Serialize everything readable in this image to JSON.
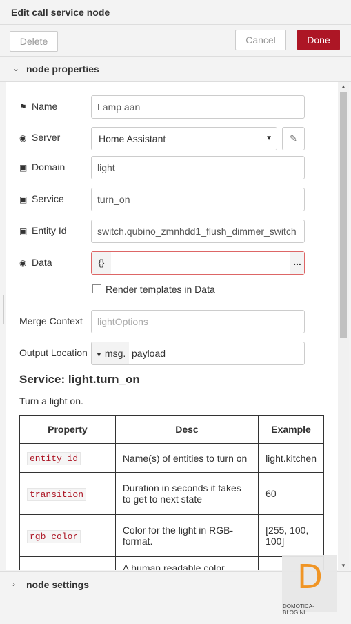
{
  "header": {
    "title": "Edit call service node"
  },
  "toolbar": {
    "delete_label": "Delete",
    "cancel_label": "Cancel",
    "done_label": "Done"
  },
  "sections": {
    "node_properties": "node properties",
    "node_settings": "node settings"
  },
  "form": {
    "name": {
      "label": "Name",
      "value": "Lamp aan"
    },
    "server": {
      "label": "Server",
      "value": "Home Assistant"
    },
    "domain": {
      "label": "Domain",
      "value": "light"
    },
    "service": {
      "label": "Service",
      "value": "turn_on"
    },
    "entity_id": {
      "label": "Entity Id",
      "value": "switch.qubino_zmnhdd1_flush_dimmer_switch"
    },
    "data": {
      "label": "Data",
      "type_badge": "{}",
      "more": "..."
    },
    "render_templates": {
      "label": "Render templates in Data",
      "checked": false
    },
    "merge_context": {
      "label": "Merge Context",
      "placeholder": "lightOptions"
    },
    "output_location": {
      "label": "Output Location",
      "prefix": "msg.",
      "value": "payload"
    }
  },
  "service_info": {
    "title": "Service: light.turn_on",
    "description": "Turn a light on.",
    "columns": [
      "Property",
      "Desc",
      "Example"
    ],
    "rows": [
      {
        "property": "entity_id",
        "desc": "Name(s) of entities to turn on",
        "example": "light.kitchen"
      },
      {
        "property": "transition",
        "desc": "Duration in seconds it takes to get to next state",
        "example": "60"
      },
      {
        "property": "rgb_color",
        "desc": "Color for the light in RGB-format.",
        "example": "[255, 100, 100]"
      },
      {
        "property": "",
        "desc": "A human readable color",
        "example": ""
      }
    ]
  },
  "watermark": {
    "letter": "D",
    "text": "DOMOTICA-BLOG.NL"
  },
  "colors": {
    "done_button": "#ad1625",
    "data_border": "#dd6666",
    "watermark_letter": "#f0901a"
  }
}
